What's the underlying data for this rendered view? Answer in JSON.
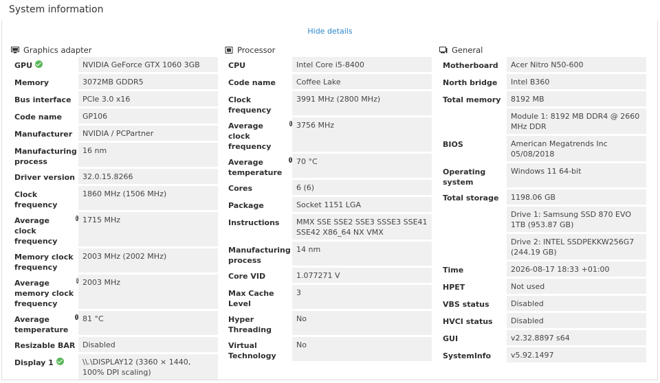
{
  "header": {
    "title": "System information",
    "hide_details": "Hide details"
  },
  "graphics": {
    "heading": "Graphics adapter",
    "icon": "monitor-icon",
    "rows": [
      {
        "label": "GPU",
        "value": "NVIDIA GeForce GTX 1060 3GB",
        "ok": true
      },
      {
        "label": "Memory",
        "value": "3072MB GDDR5"
      },
      {
        "label": "Bus interface",
        "value": "PCIe 3.0 x16"
      },
      {
        "label": "Code name",
        "value": "GP106"
      },
      {
        "label": "Manufacturer",
        "value": "NVIDIA / PCPartner"
      },
      {
        "label": "Manufacturing process",
        "value": "16 nm"
      },
      {
        "label": "Driver version",
        "value": "32.0.15.8266"
      },
      {
        "label": "Clock frequency",
        "value": "1860 MHz (1506 MHz)"
      },
      {
        "label": "Average clock frequency",
        "value": "1715 MHz",
        "info": true
      },
      {
        "label": "Memory clock frequency",
        "value": "2003 MHz (2002 MHz)"
      },
      {
        "label": "Average memory clock frequency",
        "value": "2003 MHz",
        "info": true
      },
      {
        "label": "Average temperature",
        "value": "81 °C",
        "info": true
      },
      {
        "label": "Resizable BAR",
        "value": "Disabled"
      },
      {
        "label": "Display 1",
        "value": "\\\\.\\DISPLAY12 (3360 × 1440, 100% DPI scaling)",
        "ok": true
      }
    ]
  },
  "processor": {
    "heading": "Processor",
    "icon": "cpu-icon",
    "rows": [
      {
        "label": "CPU",
        "value": "Intel Core i5-8400"
      },
      {
        "label": "Code name",
        "value": "Coffee Lake"
      },
      {
        "label": "Clock frequency",
        "value": "3991 MHz (2800 MHz)"
      },
      {
        "label": "Average clock frequency",
        "value": "3756 MHz",
        "info": true
      },
      {
        "label": "Average temperature",
        "value": "70 °C",
        "info": true
      },
      {
        "label": "Cores",
        "value": "6 (6)"
      },
      {
        "label": "Package",
        "value": "Socket 1151 LGA"
      },
      {
        "label": "Instructions",
        "value": "MMX SSE SSE2 SSE3 SSSE3 SSE41 SSE42 X86_64 NX VMX"
      },
      {
        "label": "Manufacturing process",
        "value": "14 nm"
      },
      {
        "label": "Core VID",
        "value": "1.077271 V"
      },
      {
        "label": "Max Cache Level",
        "value": "3"
      },
      {
        "label": "Hyper Threading",
        "value": "No"
      },
      {
        "label": "Virtual Technology",
        "value": "No"
      }
    ]
  },
  "general": {
    "heading": "General",
    "icon": "computer-icon",
    "rows": [
      {
        "label": "Motherboard",
        "value": "Acer Nitro N50-600"
      },
      {
        "label": "North bridge",
        "value": "Intel B360"
      },
      {
        "label": "Total memory",
        "value": "8192 MB"
      },
      {
        "label": "",
        "value": "Module 1: 8192 MB DDR4 @ 2660 MHz DDR"
      },
      {
        "label": "BIOS",
        "value": "American Megatrends Inc 05/08/2018"
      },
      {
        "label": "Operating system",
        "value": "Windows 11 64-bit"
      },
      {
        "label": "Total storage",
        "value": "1198.06 GB"
      },
      {
        "label": "",
        "value": "Drive 1: Samsung SSD 870 EVO 1TB (953.87 GB)"
      },
      {
        "label": "",
        "value": "Drive 2: INTEL SSDPEKKW256G7 (244.19 GB)"
      },
      {
        "label": "Time",
        "value": "2026-08-17 18:33 +01:00"
      },
      {
        "label": "HPET",
        "value": "Not used"
      },
      {
        "label": "VBS status",
        "value": "Disabled"
      },
      {
        "label": "HVCI status",
        "value": "Disabled"
      },
      {
        "label": "GUI",
        "value": "v2.32.8897 s64"
      },
      {
        "label": "SystemInfo",
        "value": "v5.92.1497"
      }
    ]
  }
}
